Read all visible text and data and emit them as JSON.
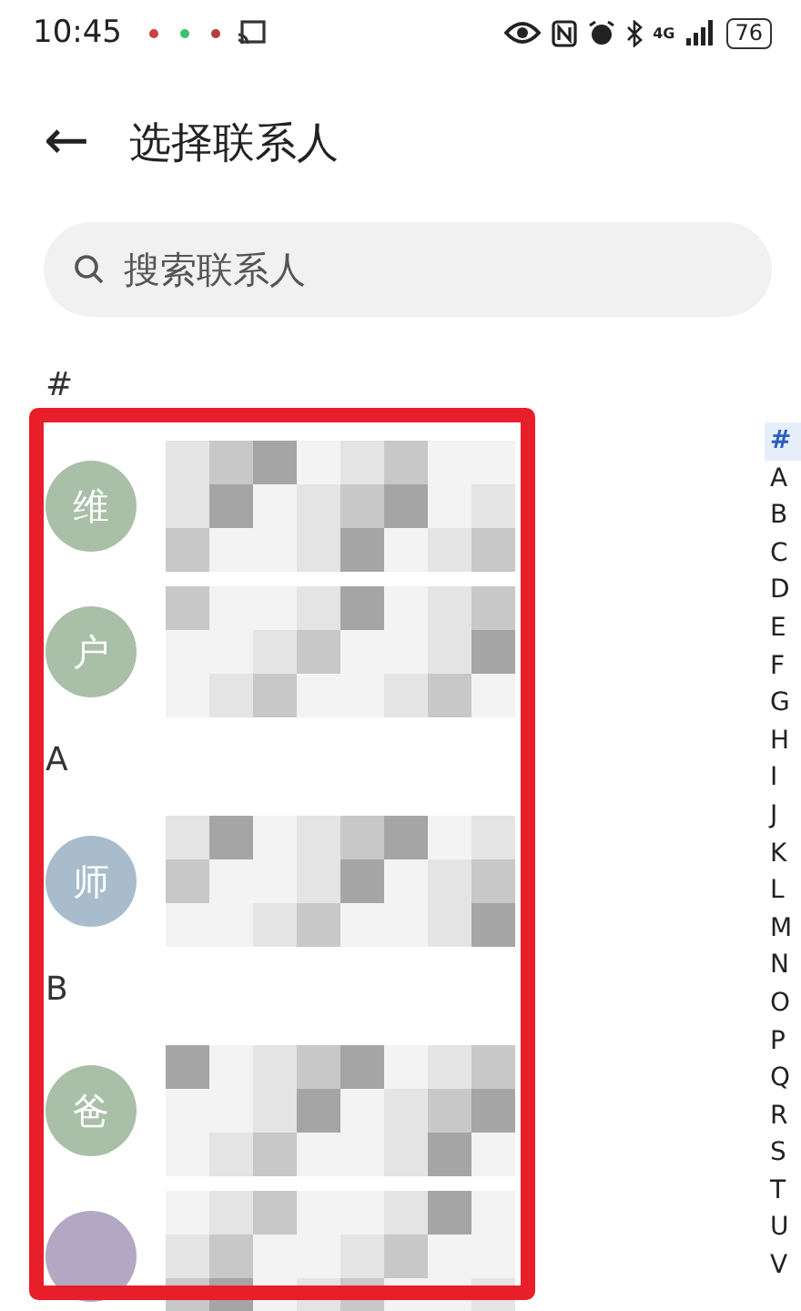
{
  "status_bar": {
    "time": "10:45",
    "network": "4G",
    "battery": "76"
  },
  "header": {
    "back": "←",
    "title": "选择联系人"
  },
  "search": {
    "placeholder": "搜索联系人"
  },
  "sections": [
    {
      "letter": "#",
      "contacts": [
        {
          "avatar": "维",
          "color": "#a9bfa8"
        },
        {
          "avatar": "户",
          "color": "#a9bfa8"
        }
      ]
    },
    {
      "letter": "A",
      "contacts": [
        {
          "avatar": "师",
          "color": "#a8bccb"
        }
      ]
    },
    {
      "letter": "B",
      "contacts": [
        {
          "avatar": "爸",
          "color": "#a9bfa8"
        },
        {
          "color": "#b3a8c4"
        }
      ]
    }
  ],
  "index": [
    {
      "letter": "#",
      "selected": true
    },
    {
      "letter": "A",
      "selected": false
    },
    {
      "letter": "B",
      "selected": false
    },
    {
      "letter": "C",
      "selected": false
    },
    {
      "letter": "D",
      "selected": false
    },
    {
      "letter": "E",
      "selected": false
    },
    {
      "letter": "F",
      "selected": false
    },
    {
      "letter": "G",
      "selected": false
    },
    {
      "letter": "H",
      "selected": false
    },
    {
      "letter": "I",
      "selected": false
    },
    {
      "letter": "J",
      "selected": false
    },
    {
      "letter": "K",
      "selected": false
    },
    {
      "letter": "L",
      "selected": false
    },
    {
      "letter": "M",
      "selected": false
    },
    {
      "letter": "N",
      "selected": false
    },
    {
      "letter": "O",
      "selected": false
    },
    {
      "letter": "P",
      "selected": false
    },
    {
      "letter": "Q",
      "selected": false
    },
    {
      "letter": "R",
      "selected": false
    },
    {
      "letter": "S",
      "selected": false
    },
    {
      "letter": "T",
      "selected": false
    },
    {
      "letter": "U",
      "selected": false
    },
    {
      "letter": "V",
      "selected": false
    }
  ]
}
